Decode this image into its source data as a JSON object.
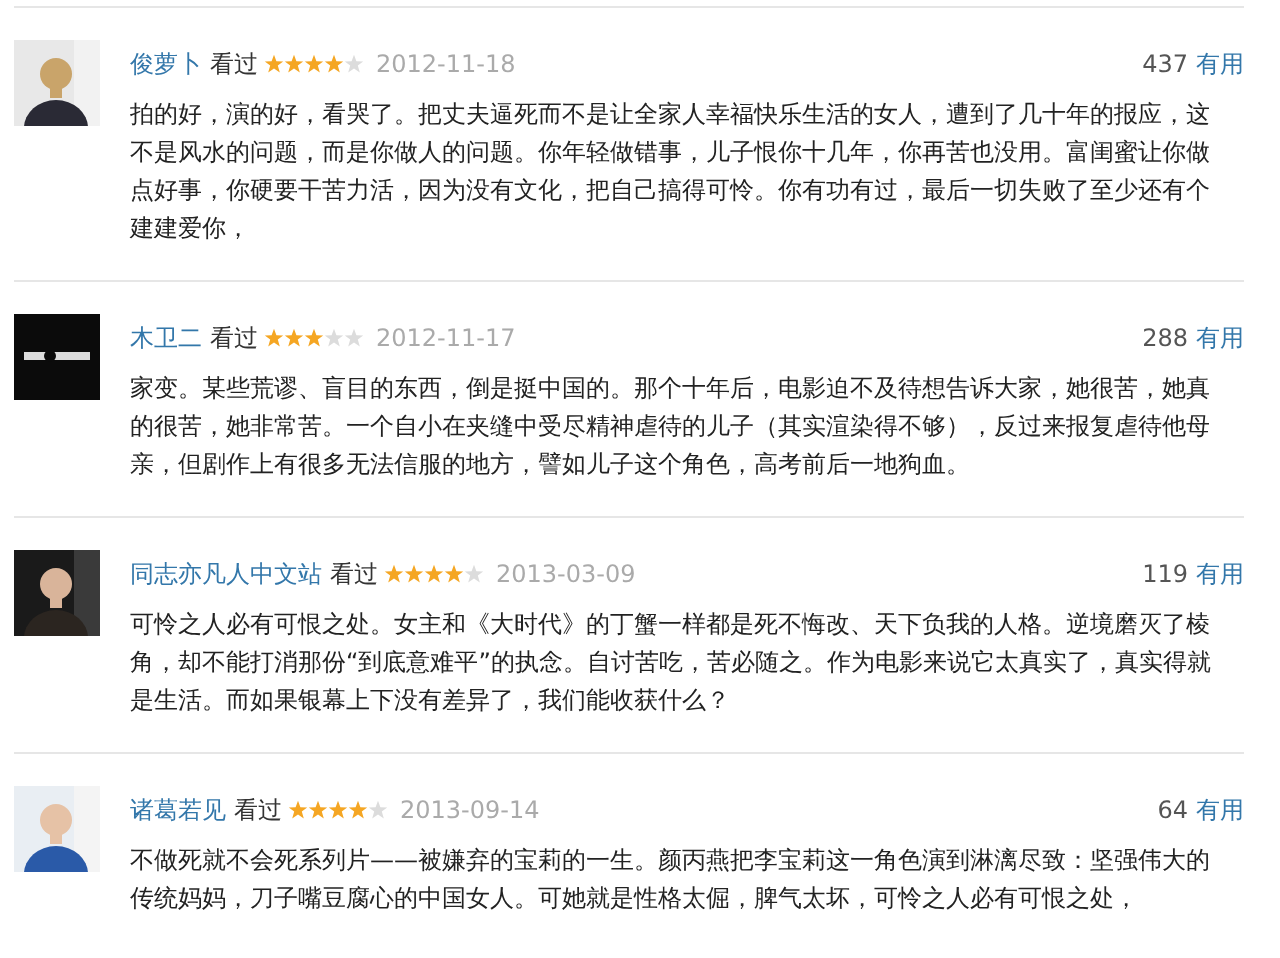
{
  "reviews": [
    {
      "user": "俊萝卜",
      "status": "看过",
      "stars": 4,
      "date": "2012-11-18",
      "votes": "437",
      "votes_label": "有用",
      "text": "拍的好，演的好，看哭了。把丈夫逼死而不是让全家人幸福快乐生活的女人，遭到了几十年的报应，这不是风水的问题，而是你做人的问题。你年轻做错事，儿子恨你十几年，你再苦也没用。富闺蜜让你做点好事，你硬要干苦力活，因为没有文化，把自己搞得可怜。你有功有过，最后一切失败了至少还有个建建爱你，"
    },
    {
      "user": "木卫二",
      "status": "看过",
      "stars": 3,
      "date": "2012-11-17",
      "votes": "288",
      "votes_label": "有用",
      "text": "家变。某些荒谬、盲目的东西，倒是挺中国的。那个十年后，电影迫不及待想告诉大家，她很苦，她真的很苦，她非常苦。一个自小在夹缝中受尽精神虐待的儿子（其实渲染得不够），反过来报复虐待他母亲，但剧作上有很多无法信服的地方，譬如儿子这个角色，高考前后一地狗血。"
    },
    {
      "user": "同志亦凡人中文站",
      "status": "看过",
      "stars": 4,
      "date": "2013-03-09",
      "votes": "119",
      "votes_label": "有用",
      "text": "可怜之人必有可恨之处。女主和《大时代》的丁蟹一样都是死不悔改、天下负我的人格。逆境磨灭了棱角，却不能打消那份“到底意难平”的执念。自讨苦吃，苦必随之。作为电影来说它太真实了，真实得就是生活。而如果银幕上下没有差异了，我们能收获什么？"
    },
    {
      "user": "诸葛若见",
      "status": "看过",
      "stars": 4,
      "date": "2013-09-14",
      "votes": "64",
      "votes_label": "有用",
      "text": "不做死就不会死系列片——被嫌弃的宝莉的一生。颜丙燕把李宝莉这一角色演到淋漓尽致：坚强伟大的传统妈妈，刀子嘴豆腐心的中国女人。可她就是性格太倔，脾气太坏，可怜之人必有可恨之处，"
    }
  ]
}
